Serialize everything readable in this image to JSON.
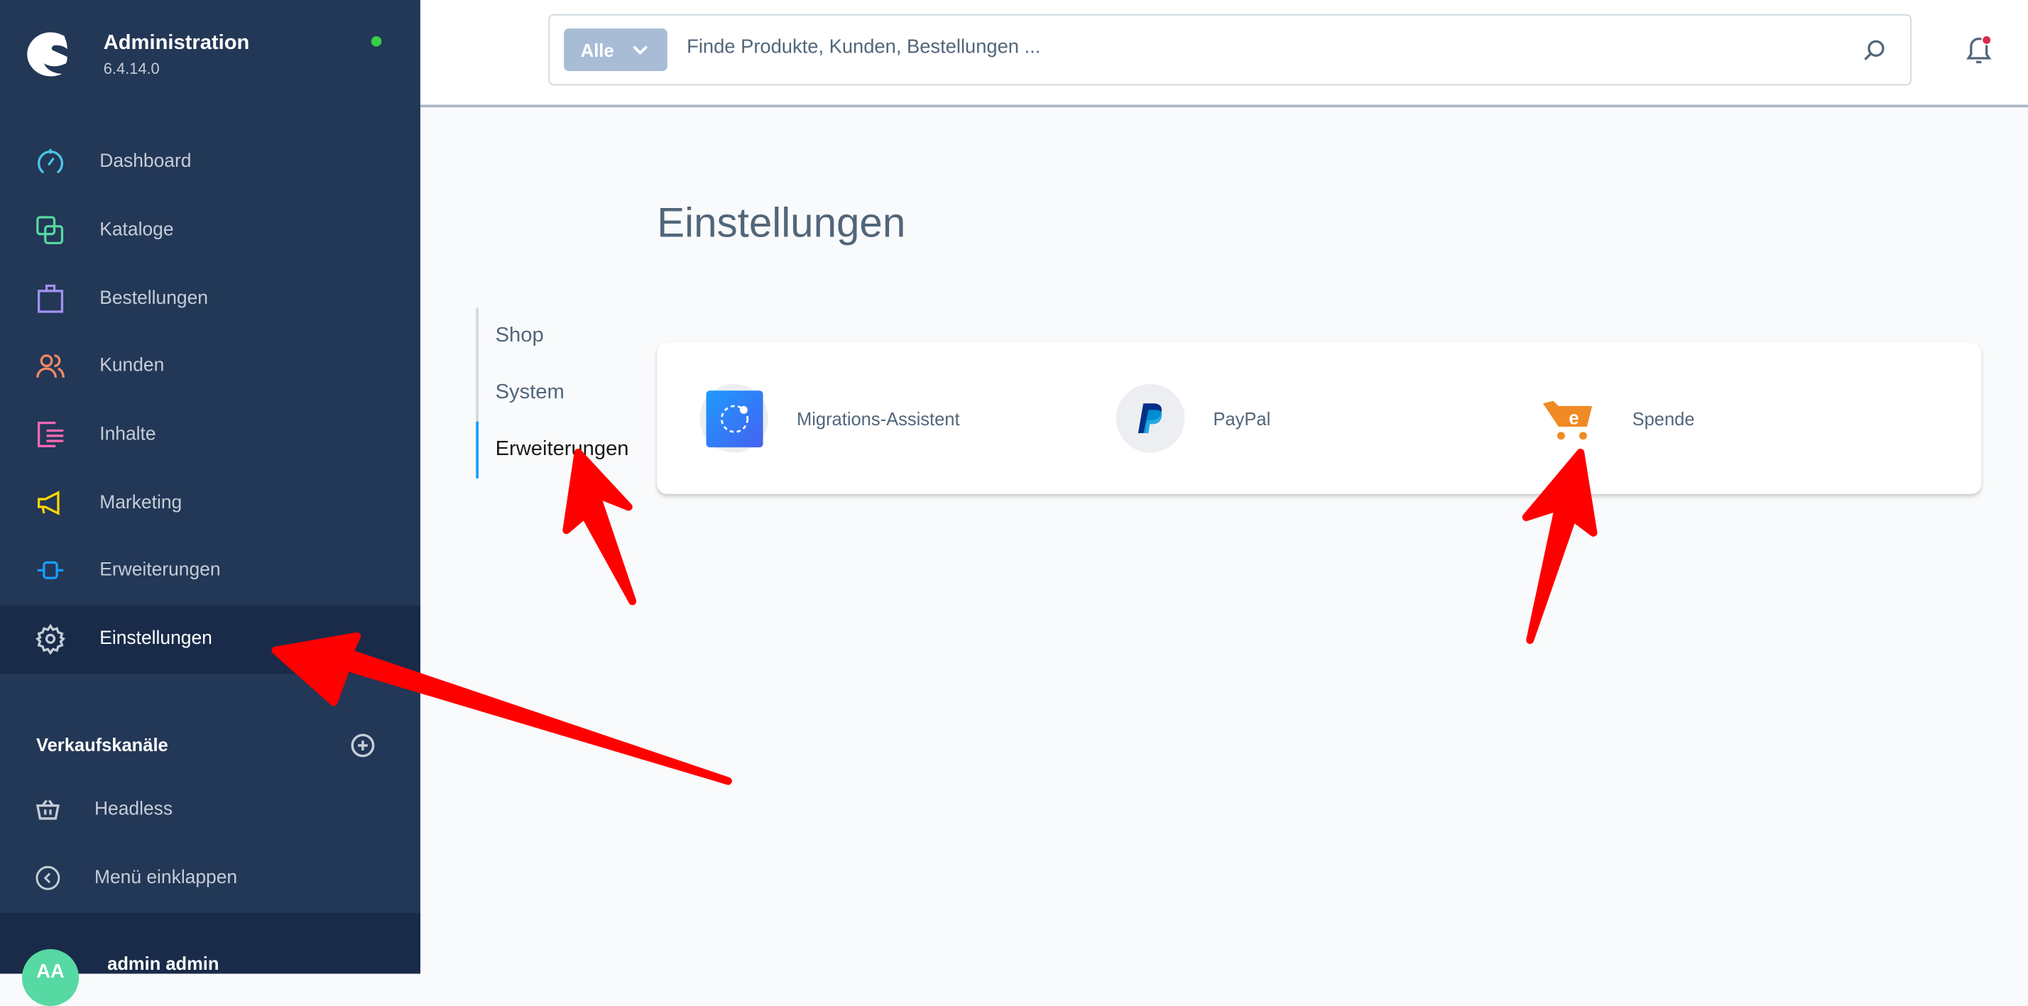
{
  "brand": {
    "title": "Administration",
    "version": "6.4.14.0"
  },
  "nav": {
    "items": [
      {
        "label": "Dashboard",
        "icon": "dashboard-icon",
        "color": "#4dc6e8"
      },
      {
        "label": "Kataloge",
        "icon": "catalog-icon",
        "color": "#57d9a3"
      },
      {
        "label": "Bestellungen",
        "icon": "shopping-bag-icon",
        "color": "#a092f0"
      },
      {
        "label": "Kunden",
        "icon": "users-icon",
        "color": "#f88962"
      },
      {
        "label": "Inhalte",
        "icon": "content-icon",
        "color": "#ff68b4"
      },
      {
        "label": "Marketing",
        "icon": "megaphone-icon",
        "color": "#ffd700"
      },
      {
        "label": "Erweiterungen",
        "icon": "plug-icon",
        "color": "#189eff"
      },
      {
        "label": "Einstellungen",
        "icon": "gear-icon",
        "color": "#c5cdd8",
        "active": true
      }
    ]
  },
  "sales_channels": {
    "title": "Verkaufskanäle",
    "items": [
      {
        "label": "Headless",
        "icon": "basket-icon"
      }
    ],
    "collapse_label": "Menü einklappen"
  },
  "user": {
    "initials": "AA",
    "name": "admin admin"
  },
  "search": {
    "type_label": "Alle",
    "placeholder": "Finde Produkte, Kunden, Bestellungen ..."
  },
  "page": {
    "title": "Einstellungen"
  },
  "tabs": [
    {
      "label": "Shop"
    },
    {
      "label": "System"
    },
    {
      "label": "Erweiterungen",
      "active": true
    }
  ],
  "extensions": [
    {
      "label": "Migrations-Assistent"
    },
    {
      "label": "PayPal"
    },
    {
      "label": "Spende"
    }
  ],
  "colors": {
    "sidebar": "#233756",
    "accent": "#189eff",
    "annotation": "#ff0000"
  }
}
